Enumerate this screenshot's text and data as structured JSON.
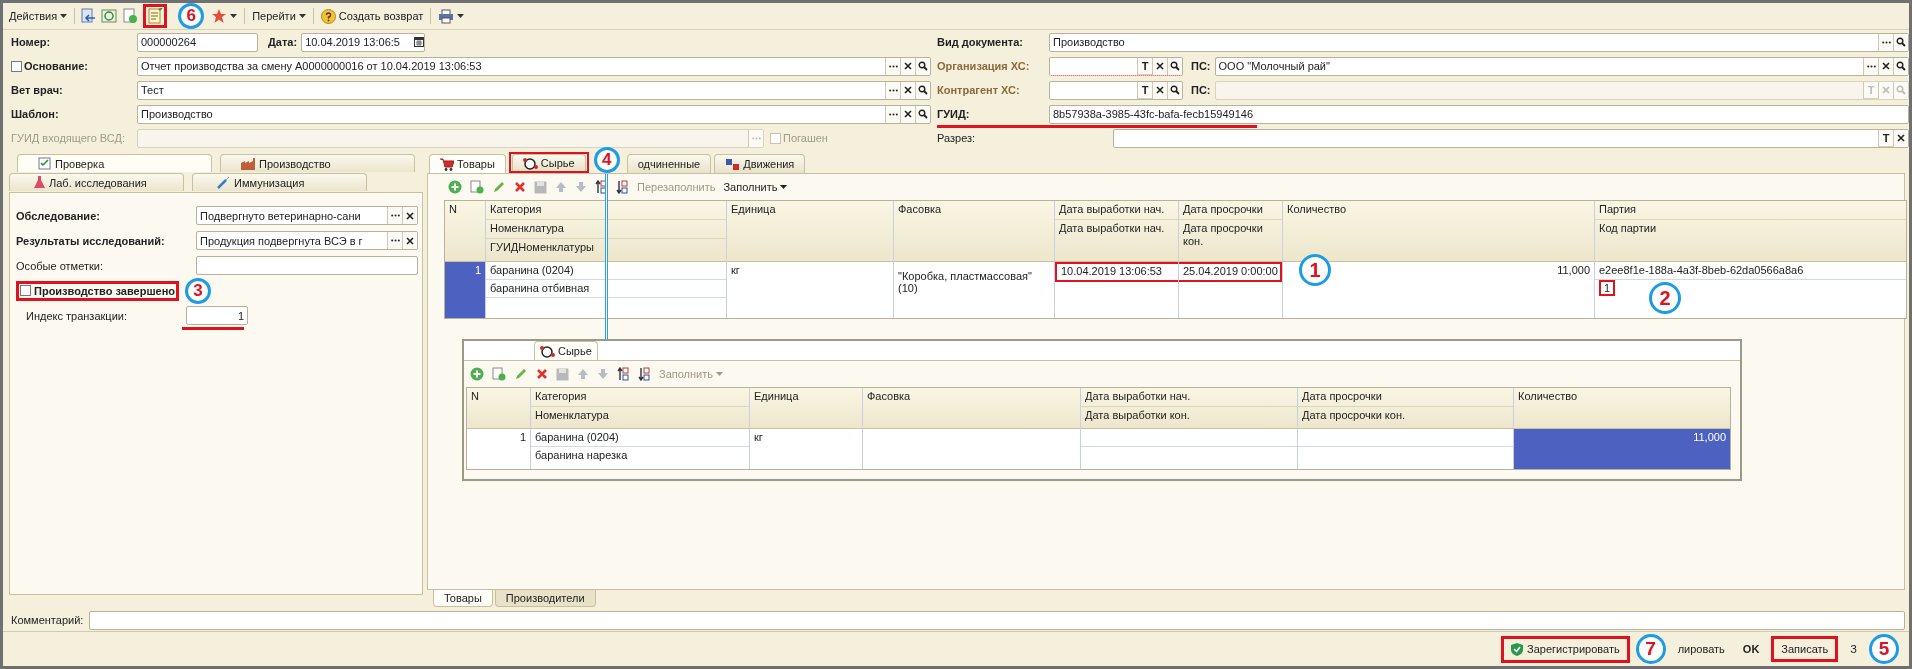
{
  "toolbar": {
    "actions_menu": "Действия",
    "goto_menu": "Перейти",
    "create_return": "Создать возврат"
  },
  "header": {
    "number": {
      "label": "Номер:",
      "value": "000000264"
    },
    "date": {
      "label": "Дата:",
      "value": "10.04.2019 13:06:5"
    },
    "basis": {
      "label": "Основание:",
      "checked": false,
      "value": "Отчет производства за смену A0000000016 от 10.04.2019 13:06:53",
      "buttons": [
        {
          "kind": "choice"
        },
        {
          "kind": "clear"
        },
        {
          "kind": "search"
        }
      ]
    },
    "vet": {
      "label": "Вет врач:",
      "value": "Тест",
      "buttons": [
        {
          "kind": "choice"
        },
        {
          "kind": "clear"
        },
        {
          "kind": "search"
        }
      ]
    },
    "template": {
      "label": "Шаблон:",
      "value": "Производство",
      "buttons": [
        {
          "kind": "choice"
        },
        {
          "kind": "clear"
        },
        {
          "kind": "search"
        }
      ]
    },
    "incoming_guid": {
      "label": "ГУИД входящего ВСД:",
      "disabled": true,
      "buttons": [
        {
          "kind": "choice"
        }
      ]
    },
    "repaid": {
      "label": "Погашен",
      "checked": false,
      "disabled": true
    },
    "doc_type": {
      "label": "Вид документа:",
      "value": "Производство",
      "buttons": [
        {
          "kind": "choice"
        },
        {
          "kind": "search"
        }
      ]
    },
    "org": {
      "label": "Организация ХС:",
      "buttons": [
        {
          "kind": "type",
          "label": "T"
        },
        {
          "kind": "clear"
        },
        {
          "kind": "search"
        }
      ]
    },
    "org_ps": {
      "label": "ПС:",
      "value": "ООО \"Молочный рай\"",
      "buttons": [
        {
          "kind": "choice"
        },
        {
          "kind": "clear"
        },
        {
          "kind": "search"
        }
      ]
    },
    "counterparty": {
      "label": "Контрагент ХС:",
      "buttons": [
        {
          "kind": "type",
          "label": "T"
        },
        {
          "kind": "clear"
        },
        {
          "kind": "search"
        }
      ]
    },
    "counterparty_ps": {
      "label": "ПС:",
      "disabled": true,
      "buttons": [
        {
          "kind": "type",
          "label": "T"
        },
        {
          "kind": "clear"
        },
        {
          "kind": "search"
        }
      ]
    },
    "guid": {
      "label": "ГУИД:",
      "value": "8b57938a-3985-43fc-bafa-fecb15949146"
    },
    "section": {
      "label": "Разрез:",
      "buttons": [
        {
          "kind": "type",
          "label": "T"
        },
        {
          "kind": "clear"
        }
      ]
    }
  },
  "left_tabs": [
    [
      {
        "label": "Проверка",
        "selected": true
      },
      {
        "label": "Производство",
        "selected": false
      }
    ],
    [
      {
        "label": "Лаб. исследования",
        "selected": false
      },
      {
        "label": "Иммунизация",
        "selected": false
      }
    ]
  ],
  "check": {
    "inspection": {
      "label": "Обследование:",
      "value": "Подвергнуто ветеринарно-сани"
    },
    "results": {
      "label": "Результаты исследований:",
      "value": "Продукция подвергнута ВСЭ в г"
    },
    "notes": {
      "label": "Особые отметки:"
    },
    "finished": {
      "label": "Производство завершено",
      "checked": false
    },
    "tx_index": {
      "label": "Индекс транзакции:",
      "value": "1"
    }
  },
  "doc_tabs": [
    {
      "label": "Товары",
      "selected": true
    },
    {
      "label": "Сырье",
      "selected": false
    },
    {
      "label": "одчиненные",
      "selected": false
    },
    {
      "label": "Движения",
      "selected": false
    }
  ],
  "goods": {
    "refill": {
      "label": "Перезаполнить",
      "disabled": true
    },
    "fill": "Заполнить",
    "columns": [
      {
        "header": [
          "N"
        ]
      },
      {
        "header": [
          "Категория",
          "Номенклатура",
          "ГУИДНоменклатуры"
        ]
      },
      {
        "header": [
          "Единица"
        ]
      },
      {
        "header": [
          "Фасовка"
        ]
      },
      {
        "header": [
          "Дата выработки нач.",
          "Дата выработки нач."
        ]
      },
      {
        "header": [
          "Дата просрочки",
          "Дата просрочки кон."
        ]
      },
      {
        "header": [
          "Количество"
        ]
      },
      {
        "header": [
          "Партия",
          "Код партии"
        ]
      }
    ],
    "rows": [
      {
        "cells": [
          {
            "lines": [
              "1"
            ],
            "selected": true
          },
          {
            "lines": [
              "баранина (0204)",
              "баранина отбивная"
            ],
            "selected": false
          },
          {
            "lines": [
              "кг"
            ],
            "selected": false
          },
          {
            "lines": [
              "\"Коробка, пластмассовая\"(10)"
            ],
            "selected": false
          },
          {
            "lines": [
              "10.04.2019 13:06:53"
            ],
            "selected": false
          },
          {
            "lines": [
              "25.04.2019 0:00:00"
            ],
            "selected": false
          },
          {
            "lines": [
              "11,000"
            ],
            "selected": false
          },
          {
            "lines": [
              "e2ee8f1e-188a-4a3f-8beb-62da0566a8a6",
              "1"
            ],
            "selected": false
          }
        ]
      }
    ]
  },
  "raw_inset": {
    "tab": "Сырье",
    "fill": "Заполнить",
    "columns": [
      {
        "header": [
          "N"
        ]
      },
      {
        "header": [
          "Категория",
          "Номенклатура"
        ]
      },
      {
        "header": [
          "Единица"
        ]
      },
      {
        "header": [
          "Фасовка"
        ]
      },
      {
        "header": [
          "Дата выработки нач.",
          "Дата выработки кон."
        ]
      },
      {
        "header": [
          "Дата просрочки",
          "Дата просрочки кон."
        ]
      },
      {
        "header": [
          "Количество"
        ]
      }
    ],
    "rows": [
      {
        "cells": [
          {
            "lines": [
              "1"
            ],
            "selected": false
          },
          {
            "lines": [
              "баранина (0204)",
              "баранина нарезка"
            ],
            "selected": false
          },
          {
            "lines": [
              "кг"
            ],
            "selected": false
          },
          {
            "selected": false
          },
          {
            "selected": false
          },
          {
            "selected": false
          },
          {
            "lines": [
              "11,000"
            ],
            "selected": true
          }
        ]
      }
    ]
  },
  "bottom_tabs": [
    {
      "label": "Товары",
      "selected": true
    },
    {
      "label": "Производители",
      "selected": false
    }
  ],
  "comment": {
    "label": "Комментарий:"
  },
  "footer": {
    "register": "Зарегистрировать",
    "annul": "лировать",
    "ok": "OK",
    "save": "Записать",
    "close": "З"
  },
  "annotations": [
    {
      "number": "6"
    },
    {
      "number": "4"
    },
    {
      "number": "3"
    },
    {
      "number": "1"
    },
    {
      "number": "2"
    },
    {
      "number": "7"
    },
    {
      "number": "5"
    }
  ]
}
